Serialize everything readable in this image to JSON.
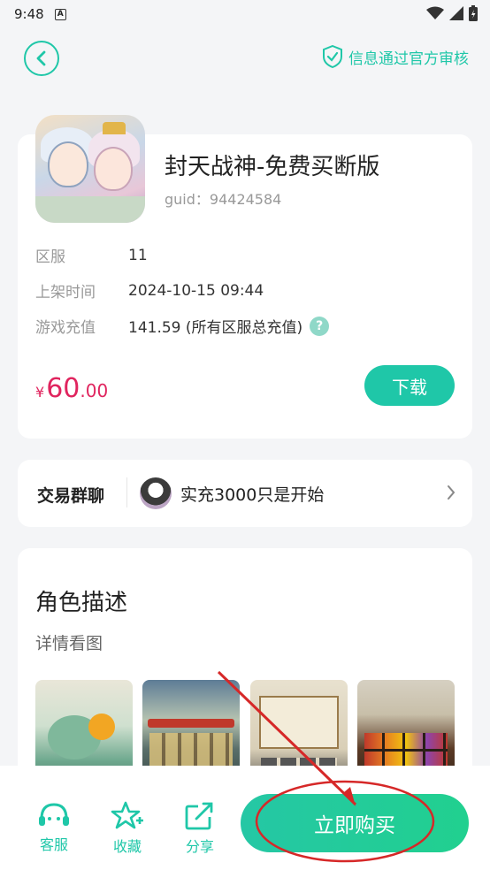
{
  "status_bar": {
    "time": "9:48",
    "notification_badge": "A"
  },
  "header": {
    "verified_text": "信息通过官方审核"
  },
  "game": {
    "title": "封天战神-免费买断版",
    "guid": "guid：94424584",
    "rows": [
      {
        "label": "区服",
        "value": "11"
      },
      {
        "label": "上架时间",
        "value": "2024-10-15 09:44"
      },
      {
        "label": "游戏充值",
        "value": "141.59  (所有区服总充值)"
      }
    ],
    "help_icon_glyph": "?",
    "price": {
      "currency": "¥",
      "integer": "60",
      "decimal": ".00"
    },
    "download_label": "下载"
  },
  "chat": {
    "label": "交易群聊",
    "message": "实充3000只是开始"
  },
  "description": {
    "title": "角色描述",
    "subtitle": "详情看图"
  },
  "bottom_nav": {
    "service_label": "客服",
    "favorite_label": "收藏",
    "share_label": "分享",
    "buy_label": "立即购买"
  },
  "colors": {
    "accent": "#1fc7a8",
    "price": "#e0245e",
    "annotation": "#d62828"
  },
  "icons": [
    "wifi-icon",
    "signal-icon",
    "battery-icon",
    "back-icon",
    "shield-check-icon",
    "help-icon",
    "chevron-right-icon",
    "headset-icon",
    "star-plus-icon",
    "share-icon"
  ]
}
